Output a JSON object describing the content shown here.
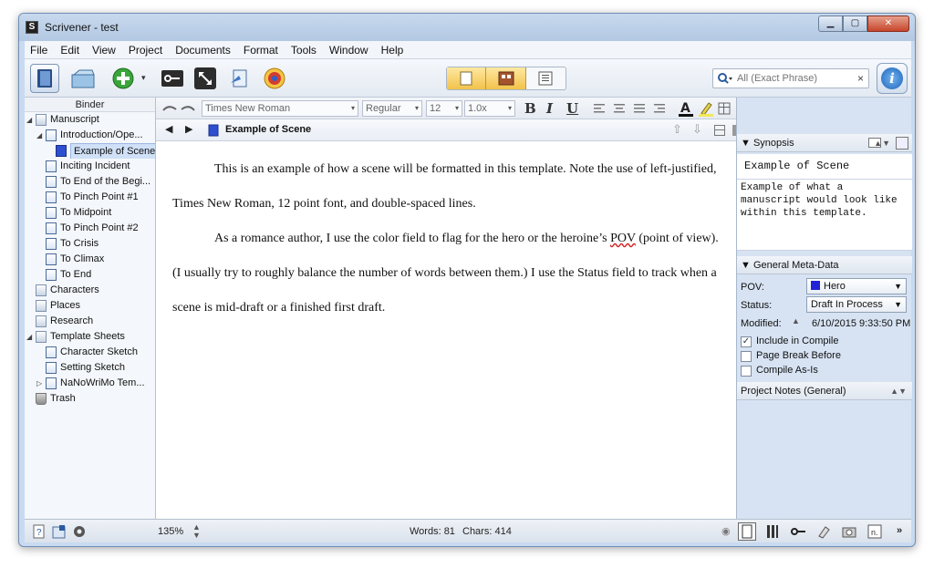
{
  "window": {
    "title": "Scrivener - test"
  },
  "menu": [
    "File",
    "Edit",
    "View",
    "Project",
    "Documents",
    "Format",
    "Tools",
    "Window",
    "Help"
  ],
  "toolbar": {
    "search_placeholder": "All (Exact Phrase)",
    "search_clear": "×"
  },
  "binder": {
    "header": "Binder",
    "items": [
      {
        "label": "Manuscript",
        "level": 0,
        "icon": "manuscript-icon",
        "expanded": true
      },
      {
        "label": "Introduction/Ope...",
        "level": 1,
        "icon": "document-stack-icon",
        "expanded": true
      },
      {
        "label": "Example of Scene",
        "level": 2,
        "icon": "document-icon",
        "selected": true
      },
      {
        "label": "Inciting Incident",
        "level": 1,
        "icon": "document-stack-icon"
      },
      {
        "label": "To End of the Begi...",
        "level": 1,
        "icon": "document-stack-icon"
      },
      {
        "label": "To Pinch Point #1",
        "level": 1,
        "icon": "document-stack-icon"
      },
      {
        "label": "To Midpoint",
        "level": 1,
        "icon": "document-stack-icon"
      },
      {
        "label": "To Pinch Point #2",
        "level": 1,
        "icon": "document-stack-icon"
      },
      {
        "label": "To Crisis",
        "level": 1,
        "icon": "document-stack-icon"
      },
      {
        "label": "To Climax",
        "level": 1,
        "icon": "document-stack-icon"
      },
      {
        "label": "To End",
        "level": 1,
        "icon": "document-stack-icon"
      },
      {
        "label": "Characters",
        "level": 0,
        "icon": "characters-icon"
      },
      {
        "label": "Places",
        "level": 0,
        "icon": "places-icon"
      },
      {
        "label": "Research",
        "level": 0,
        "icon": "research-icon"
      },
      {
        "label": "Template Sheets",
        "level": 0,
        "icon": "template-sheets-icon",
        "expanded": true
      },
      {
        "label": "Character Sketch",
        "level": 1,
        "icon": "sketch-icon"
      },
      {
        "label": "Setting Sketch",
        "level": 1,
        "icon": "sketch-icon"
      },
      {
        "label": "NaNoWriMo Tem...",
        "level": 1,
        "icon": "document-stack-icon",
        "collapsed": true
      },
      {
        "label": "Trash",
        "level": 0,
        "icon": "trash-icon"
      }
    ]
  },
  "format": {
    "font": "Times New Roman",
    "style": "Regular",
    "size": "12",
    "spacing": "1.0x"
  },
  "editor": {
    "title": "Example of Scene",
    "paragraphs": [
      "This is an example of how a scene will be formatted in this template. Note the use of left-justified, Times New Roman, 12 point font, and double-spaced lines.",
      "As a romance author, I use the color field to flag for the hero or the heroine’s ",
      "POV",
      " (point of view). (I usually try to roughly balance the number of words between them.) I use the Status field to track when a scene is mid-draft or a finished first draft."
    ]
  },
  "inspector": {
    "synopsis_header": "Synopsis",
    "synopsis_title": "Example of Scene",
    "synopsis_text": "Example of what a manuscript would look like within this template.",
    "meta_header": "General Meta-Data",
    "pov_label": "POV:",
    "pov_value": "Hero",
    "pov_color": "#2323d6",
    "status_label": "Status:",
    "status_value": "Draft In Process",
    "modified_label": "Modified:",
    "modified_value": "6/10/2015 9:33:50 PM",
    "include_compile": "Include in Compile",
    "page_break": "Page Break Before",
    "compile_as_is": "Compile As-Is",
    "notes_header": "Project Notes (General)"
  },
  "status": {
    "zoom": "135%",
    "words": "Words: 81",
    "chars": "Chars: 414",
    "more": "»"
  }
}
